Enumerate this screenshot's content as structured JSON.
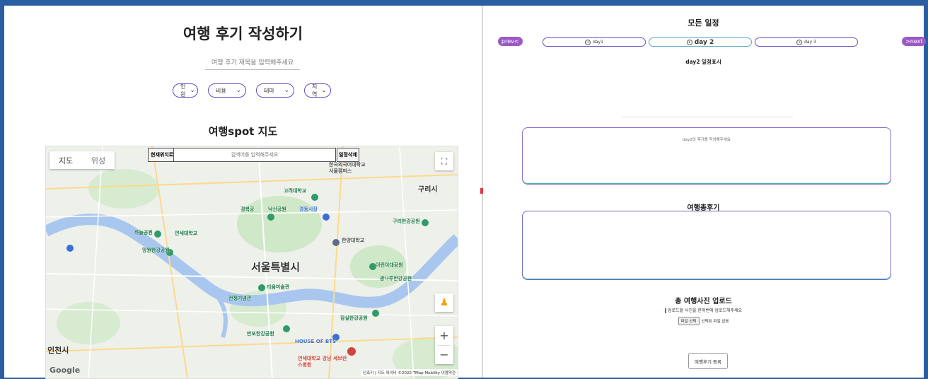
{
  "left": {
    "title": "여행 후기 작성하기",
    "title_input_placeholder": "여행 후기 제목을 입력해주세요",
    "filters": [
      "인원",
      "비용",
      "테마",
      "지역"
    ],
    "map_title": "여행spot 지도",
    "map": {
      "toggle_map": "지도",
      "toggle_satellite": "위성",
      "current_location_btn": "현재위치로",
      "search_placeholder": "검색어를 입력해주세요",
      "delete_btn": "일정삭제",
      "city_main": "서울특별시",
      "city_guri": "구리시",
      "city_incheon": "인천시",
      "google": "Google",
      "attribution": "단축키 | 지도 데이터 ©2022 TMap Mobility 이용약관",
      "pois": [
        "경복궁",
        "낙산공원",
        "고려대학교",
        "경동시장",
        "연세대학교",
        "하늘공원",
        "망원한강공원",
        "구리한강공원",
        "어린이대공원",
        "광나루한강공원",
        "전쟁기념관",
        "리움미술관",
        "잠실한강공원",
        "반포한강공원",
        "HOUSE OF BTS",
        "연세대학교 강남 세브란스병원",
        "한국외국어대학교 서울캠퍼스",
        "한양대학교"
      ]
    }
  },
  "right": {
    "all_schedule": "모든 일정",
    "prev": "prev<",
    "next": ">next",
    "days": [
      "day1",
      "day 2",
      "day 3"
    ],
    "day_sub": "day2 일정표시",
    "review_placeholder": "day2의 후기를 작성해주세요",
    "total_title": "여행총후기",
    "photo_title": "총 여행사진 업로드",
    "photo_sub": "업로드할 사진을 한꺼번에 업로드해주세요",
    "file_btn": "파일 선택",
    "file_status": "선택된 파일 없음",
    "submit": "여행후기 등록"
  }
}
